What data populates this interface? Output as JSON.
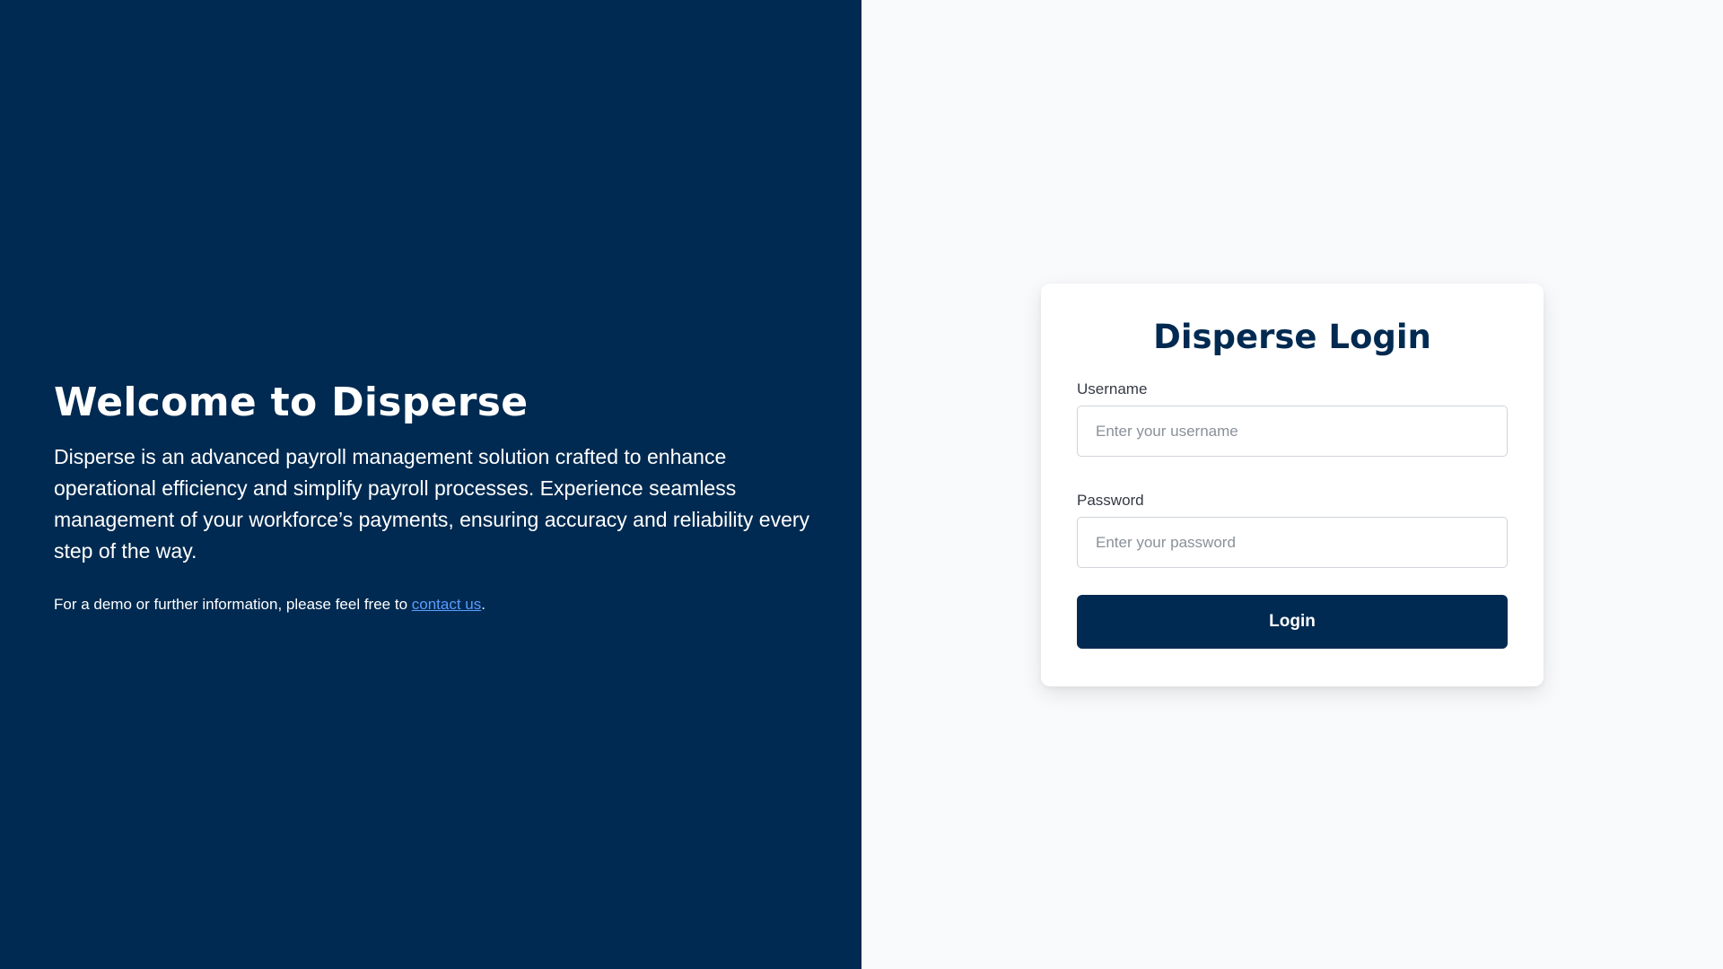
{
  "colors": {
    "left_panel_bg": "#002a51",
    "right_panel_bg": "#f9fafc",
    "primary": "#002a51",
    "link": "#5b9cff"
  },
  "welcome": {
    "title": "Welcome to Disperse",
    "description": "Disperse is an advanced payroll management solution crafted to enhance operational efficiency and simplify payroll processes. Experience seamless management of your workforce’s payments, ensuring accuracy and reliability every step of the way.",
    "contact_prefix": "For a demo or further information, please feel free to ",
    "contact_link": "contact us",
    "contact_suffix": "."
  },
  "login": {
    "title": "Disperse Login",
    "username_label": "Username",
    "username_placeholder": "Enter your username",
    "username_value": "",
    "password_label": "Password",
    "password_placeholder": "Enter your password",
    "password_value": "",
    "button_label": "Login"
  }
}
